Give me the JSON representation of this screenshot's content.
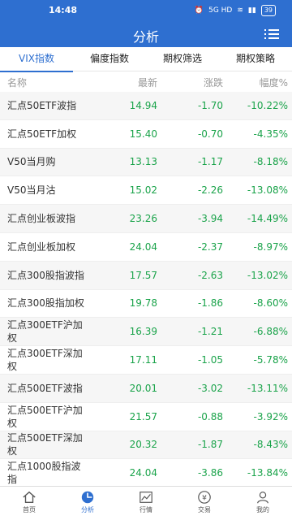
{
  "status_bar": {
    "time": "14:48",
    "network": "5G HD",
    "battery": "39"
  },
  "header": {
    "title": "分析"
  },
  "tabs": [
    {
      "label": "VIX指数",
      "active": true
    },
    {
      "label": "偏度指数",
      "active": false
    },
    {
      "label": "期权筛选",
      "active": false
    },
    {
      "label": "期权策略",
      "active": false
    }
  ],
  "columns": {
    "name": "名称",
    "latest": "最新",
    "change": "涨跌",
    "pct": "幅度%"
  },
  "rows": [
    {
      "name": "汇点50ETF波指",
      "latest": "14.94",
      "change": "-1.70",
      "pct": "-10.22%"
    },
    {
      "name": "汇点50ETF加权",
      "latest": "15.40",
      "change": "-0.70",
      "pct": "-4.35%"
    },
    {
      "name": "V50当月购",
      "latest": "13.13",
      "change": "-1.17",
      "pct": "-8.18%"
    },
    {
      "name": "V50当月沽",
      "latest": "15.02",
      "change": "-2.26",
      "pct": "-13.08%"
    },
    {
      "name": "汇点创业板波指",
      "latest": "23.26",
      "change": "-3.94",
      "pct": "-14.49%"
    },
    {
      "name": "汇点创业板加权",
      "latest": "24.04",
      "change": "-2.37",
      "pct": "-8.97%"
    },
    {
      "name": "汇点300股指波指",
      "latest": "17.57",
      "change": "-2.63",
      "pct": "-13.02%"
    },
    {
      "name": "汇点300股指加权",
      "latest": "19.78",
      "change": "-1.86",
      "pct": "-8.60%"
    },
    {
      "name": "汇点300ETF沪加权",
      "latest": "16.39",
      "change": "-1.21",
      "pct": "-6.88%"
    },
    {
      "name": "汇点300ETF深加权",
      "latest": "17.11",
      "change": "-1.05",
      "pct": "-5.78%"
    },
    {
      "name": "汇点500ETF波指",
      "latest": "20.01",
      "change": "-3.02",
      "pct": "-13.11%"
    },
    {
      "name": "汇点500ETF沪加权",
      "latest": "21.57",
      "change": "-0.88",
      "pct": "-3.92%"
    },
    {
      "name": "汇点500ETF深加权",
      "latest": "20.32",
      "change": "-1.87",
      "pct": "-8.43%"
    },
    {
      "name": "汇点1000股指波指",
      "latest": "24.04",
      "change": "-3.86",
      "pct": "-13.84%"
    }
  ],
  "bottom_nav": [
    {
      "label": "首页",
      "icon": "home-icon",
      "active": false
    },
    {
      "label": "分析",
      "icon": "pie-chart-icon",
      "active": true
    },
    {
      "label": "行情",
      "icon": "line-chart-icon",
      "active": false
    },
    {
      "label": "交易",
      "icon": "yen-icon",
      "active": false
    },
    {
      "label": "我的",
      "icon": "user-icon",
      "active": false
    }
  ],
  "colors": {
    "brand": "#2e6fd0",
    "down": "#1aa34a",
    "muted": "#999999"
  }
}
